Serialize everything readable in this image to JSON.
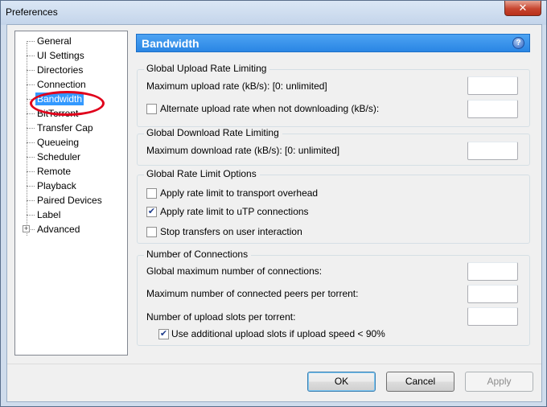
{
  "window": {
    "title": "Preferences",
    "close_glyph": "✕"
  },
  "tree": {
    "items": [
      {
        "label": "General"
      },
      {
        "label": "UI Settings"
      },
      {
        "label": "Directories"
      },
      {
        "label": "Connection"
      },
      {
        "label": "Bandwidth",
        "selected": true
      },
      {
        "label": "BitTorrent"
      },
      {
        "label": "Transfer Cap"
      },
      {
        "label": "Queueing"
      },
      {
        "label": "Scheduler"
      },
      {
        "label": "Remote"
      },
      {
        "label": "Playback"
      },
      {
        "label": "Paired Devices"
      },
      {
        "label": "Label"
      },
      {
        "label": "Advanced",
        "expandable": true
      }
    ],
    "expander_glyph": "+"
  },
  "panel": {
    "title": "Bandwidth",
    "help_glyph": "?",
    "upload": {
      "title": "Global Upload Rate Limiting",
      "max_upload_label": "Maximum upload rate (kB/s): [0: unlimited]",
      "max_upload_value": "",
      "alt_upload_label": "Alternate upload rate when not downloading (kB/s):",
      "alt_upload_checked": false,
      "alt_upload_value": ""
    },
    "download": {
      "title": "Global Download Rate Limiting",
      "max_download_label": "Maximum download rate (kB/s): [0: unlimited]",
      "max_download_value": ""
    },
    "options": {
      "title": "Global Rate Limit Options",
      "transport_overhead_label": "Apply rate limit to transport overhead",
      "transport_overhead_checked": false,
      "utp_label": "Apply rate limit to uTP connections",
      "utp_checked": true,
      "stop_transfers_label": "Stop transfers on user interaction",
      "stop_transfers_checked": false
    },
    "connections": {
      "title": "Number of Connections",
      "global_max_label": "Global maximum number of connections:",
      "global_max_value": "",
      "max_peers_label": "Maximum number of connected peers per torrent:",
      "max_peers_value": "",
      "upload_slots_label": "Number of upload slots per torrent:",
      "upload_slots_value": "",
      "additional_slots_label": "Use additional upload slots if upload speed < 90%",
      "additional_slots_checked": true
    }
  },
  "footer": {
    "ok_label": "OK",
    "cancel_label": "Cancel",
    "apply_label": "Apply"
  },
  "colors": {
    "header": "#2a86e4",
    "selection": "#3399ff",
    "annotation": "#e0001b"
  }
}
